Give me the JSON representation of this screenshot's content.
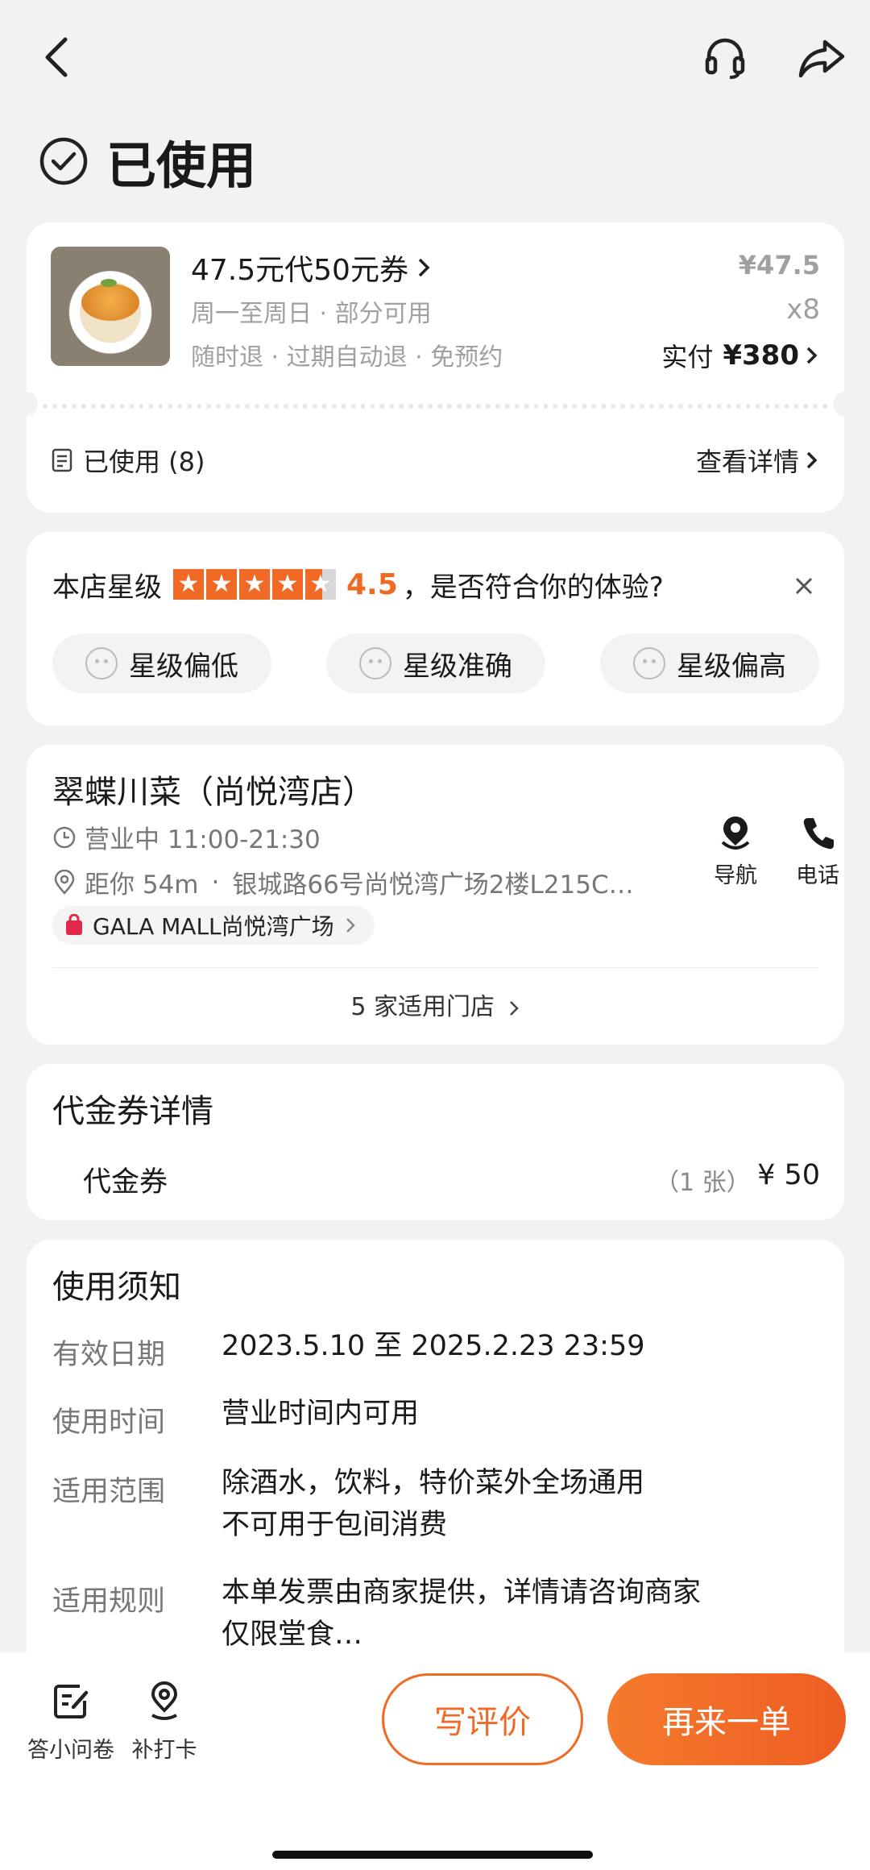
{
  "status": {
    "title": "已使用"
  },
  "order": {
    "title": "47.5元代50元券",
    "line1": "周一至周日 · 部分可用",
    "line2": "随时退 · 过期自动退 · 免预约",
    "unit_price": "¥47.5",
    "quantity": "x8",
    "paid_label": "实付",
    "paid_amount": "¥380",
    "used_label": "已使用 (8)",
    "detail_link": "查看详情"
  },
  "rating": {
    "prefix": "本店星级",
    "stars": 4.5,
    "score": "4.5",
    "question": "，是否符合你的体验?",
    "options": [
      "星级偏低",
      "星级准确",
      "星级偏高"
    ]
  },
  "store": {
    "name": "翠蝶川菜（尚悦湾店）",
    "hours": "营业中 11:00-21:30",
    "distance": "距你 54m",
    "address": "银城路66号尚悦湾广场2楼L215C…",
    "mall": "GALA MALL尚悦湾广场",
    "nav_label": "导航",
    "phone_label": "电话",
    "stores_link": "5 家适用门店"
  },
  "voucher": {
    "title": "代金券详情",
    "name": "代金券",
    "count": "（1 张）",
    "value": "¥ 50"
  },
  "notice": {
    "title": "使用须知",
    "rows": [
      {
        "label": "有效日期",
        "value": "2023.5.10 至 2025.2.23 23:59"
      },
      {
        "label": "使用时间",
        "value": "营业时间内可用"
      },
      {
        "label": "适用范围",
        "value": "除酒水，饮料，特价菜外全场通用",
        "value2": "不可用于包间消费"
      },
      {
        "label": "适用规则",
        "value": "本单发票由商家提供，详情请咨询商家",
        "value2": "仅限堂食…"
      }
    ]
  },
  "bottom": {
    "survey": "答小问卷",
    "checkin": "补打卡",
    "review": "写评价",
    "reorder": "再来一单"
  }
}
